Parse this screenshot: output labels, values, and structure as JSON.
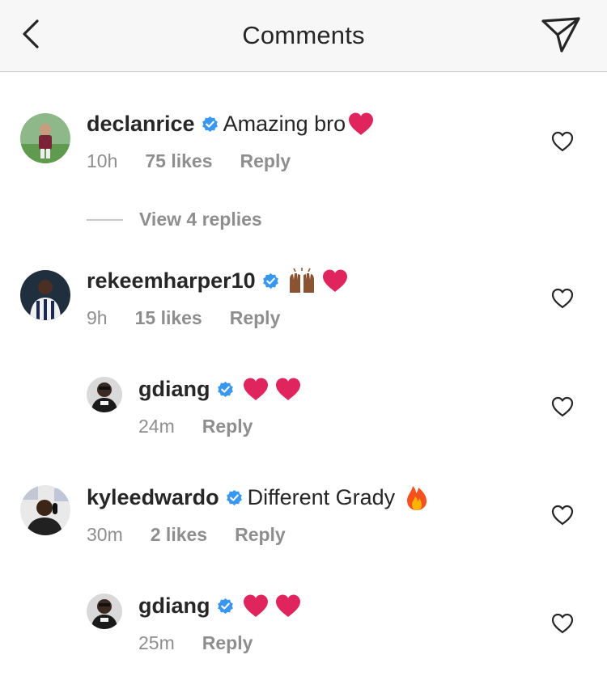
{
  "header": {
    "title": "Comments",
    "back_icon": "chevron-left-icon",
    "send_icon": "paper-plane-icon"
  },
  "comments": [
    {
      "username": "declanrice",
      "verified": true,
      "text": "Amazing bro",
      "emojis": [
        "red-heart"
      ],
      "time": "10h",
      "likes": "75 likes",
      "reply": "Reply"
    },
    {
      "username": "rekeemharper10",
      "verified": true,
      "text": "",
      "emojis": [
        "raising-hands",
        "red-heart"
      ],
      "time": "9h",
      "likes": "15 likes",
      "reply": "Reply"
    },
    {
      "username": "gdiang",
      "verified": true,
      "text": "",
      "emojis": [
        "red-heart",
        "red-heart"
      ],
      "time": "24m",
      "likes": "",
      "reply": "Reply"
    },
    {
      "username": "kyleedwardo",
      "verified": true,
      "text": "Different Grady",
      "emojis": [
        "fire"
      ],
      "time": "30m",
      "likes": "2 likes",
      "reply": "Reply"
    },
    {
      "username": "gdiang",
      "verified": true,
      "text": "",
      "emojis": [
        "red-heart",
        "red-heart"
      ],
      "time": "25m",
      "likes": "",
      "reply": "Reply"
    }
  ],
  "view_replies": {
    "label": "View 4 replies"
  },
  "colors": {
    "header_bg": "#f7f7f7",
    "text": "#262626",
    "meta": "#8e8e8e",
    "verified": "#3897f0",
    "heart_emoji": "#e0245e"
  }
}
